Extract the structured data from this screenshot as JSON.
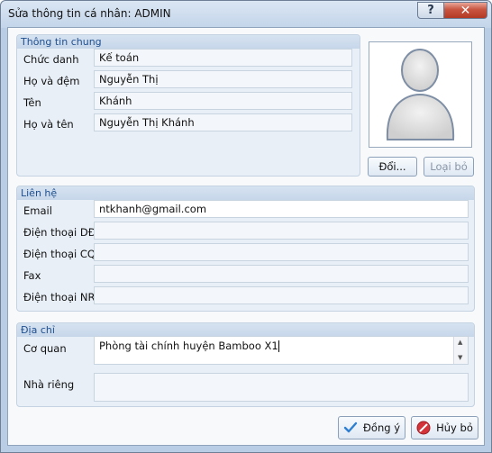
{
  "window": {
    "title": "Sửa thông tin cá nhân: ADMIN",
    "help_label": "?",
    "close_label": "✕"
  },
  "general": {
    "title": "Thông tin chung",
    "rows": [
      {
        "label": "Chức danh",
        "value": "Kế toán"
      },
      {
        "label": "Họ và đệm",
        "value": "Nguyễn Thị"
      },
      {
        "label": "Tên",
        "value": "Khánh"
      },
      {
        "label": "Họ và tên",
        "value": "Nguyễn Thị Khánh"
      }
    ]
  },
  "avatar": {
    "change_label": "Đổi...",
    "remove_label": "Loại bỏ"
  },
  "contact": {
    "title": "Liên hệ",
    "rows": [
      {
        "label": "Email",
        "value": "ntkhanh@gmail.com"
      },
      {
        "label": "Điện thoại DĐ",
        "value": ""
      },
      {
        "label": "Điện thoại CQ",
        "value": ""
      },
      {
        "label": "Fax",
        "value": ""
      },
      {
        "label": "Điện thoại NR",
        "value": ""
      }
    ]
  },
  "address": {
    "title": "Địa chỉ",
    "office_label": "Cơ quan",
    "office_value": "Phòng tài chính huyện Bamboo X1",
    "home_label": "Nhà riêng",
    "home_value": ""
  },
  "footer": {
    "ok_label": "Đồng ý",
    "cancel_label": "Hủy bỏ"
  },
  "colors": {
    "group_title": "#1f4f8f",
    "ok_check": "#2f7fd0",
    "cancel_icon": "#d4333a"
  }
}
